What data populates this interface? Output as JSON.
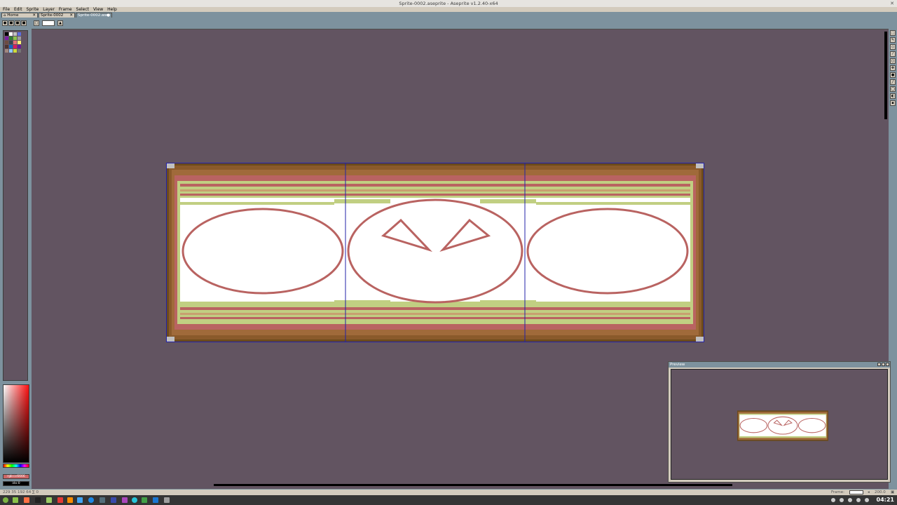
{
  "window": {
    "title": "Sprite-0002.aseprite - Aseprite v1.2.40-x64",
    "close": "✕"
  },
  "menu": [
    "File",
    "Edit",
    "Sprite",
    "Layer",
    "Frame",
    "Select",
    "View",
    "Help"
  ],
  "tabs": [
    {
      "label": "Home",
      "close": "✕"
    },
    {
      "label": "Sprite-0002",
      "close": "✕"
    },
    {
      "label": "Sprite-0002.ase",
      "close": "●"
    }
  ],
  "palette_colors": [
    "#000000",
    "#ffffff",
    "#c0c0c0",
    "#5b6ee1",
    "#7b1fa2",
    "#2e7d32",
    "#8bc34a",
    "#9e9e9e",
    "#6d4c41",
    "#37474f",
    "#e57373",
    "#fff176",
    "#4e342e",
    "#1565c0",
    "#d81b60",
    "#6a1b9a",
    "#a1887f",
    "#90caf9",
    "#cddc39",
    "#757575"
  ],
  "colors": {
    "accent": "#7d929e",
    "workspace": "#625461",
    "panel": "#d3cbbd",
    "sprite_outline": "#b96361",
    "frame_green": "#c1cf82",
    "frame_brown": "#8a5a2b",
    "frame_dark": "#6b4a1c"
  },
  "fg_color": {
    "label": "rgb:cc6666",
    "hex": "#cc6666"
  },
  "bg_color": {
    "label": "idx:0",
    "hex": "#000000"
  },
  "preview": {
    "title": "Preview"
  },
  "status": {
    "left": "229 35   192 64   ∑ 0",
    "frame_label": "Frame:",
    "zoom": "200.0"
  },
  "taskbar": {
    "clock": "04:21"
  }
}
